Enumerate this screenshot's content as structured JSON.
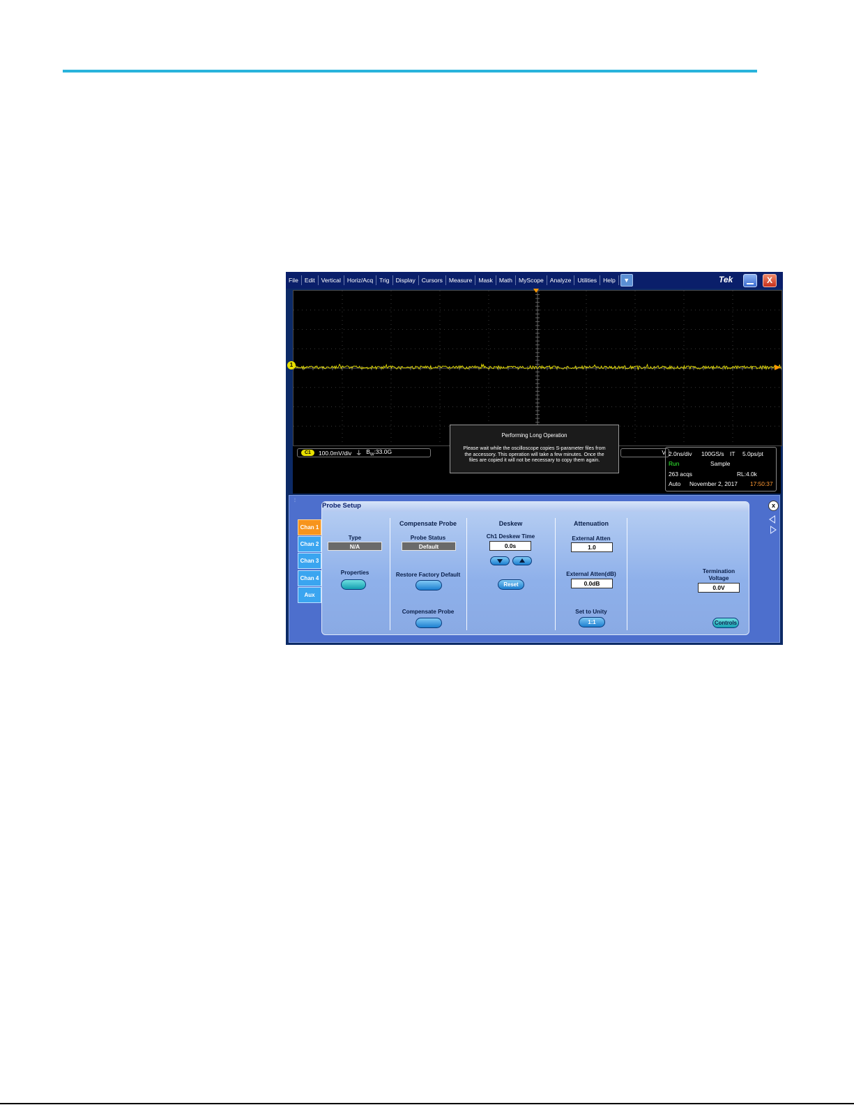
{
  "menu": {
    "items": [
      "File",
      "Edit",
      "Vertical",
      "Horiz/Acq",
      "Trig",
      "Display",
      "Cursors",
      "Measure",
      "Mask",
      "Math",
      "MyScope",
      "Analyze",
      "Utilities",
      "Help"
    ],
    "dropdown": "▼",
    "brand": "Tek",
    "close": "X"
  },
  "graticule": {
    "channel_marker": "1",
    "trace_color": "#e8e000",
    "trigger_color": "#ff9900"
  },
  "channel_readout": {
    "badge": "C1",
    "scale": "100.0mV/div",
    "bandwidth_prefix": "B",
    "bandwidth_sub": "W",
    "bandwidth_value": ":33.0G",
    "partial": "V"
  },
  "acquisition": {
    "timebase": "2.0ns/div",
    "sample_rate": "100GS/s",
    "mode_code": "IT",
    "resolution": "5.0ps/pt",
    "state": "Run",
    "acq_mode": "Sample",
    "acqs": "263 acqs",
    "record_length": "RL:4.0k",
    "trigger_mode": "Auto",
    "date": "November 2, 2017",
    "time": "17:50:37"
  },
  "long_operation": {
    "title": "Performing Long Operation",
    "message": "Please wait while the oscilloscope copies S-parameter files from the accessory. This operation will take a few minutes. Once the files are copied it will not be necessary to copy them again."
  },
  "probe_setup": {
    "title": "Probe Setup",
    "close": "x",
    "tabs": [
      "Chan 1",
      "Chan 2",
      "Chan 3",
      "Chan 4",
      "Aux"
    ],
    "type_label": "Type",
    "type_value": "N/A",
    "properties_label": "Properties",
    "compensate_header": "Compensate Probe",
    "probe_status_label": "Probe Status",
    "probe_status_value": "Default",
    "restore_label": "Restore Factory Default",
    "compensate_label": "Compensate Probe",
    "deskew_header": "Deskew",
    "deskew_time_label": "Ch1 Deskew Time",
    "deskew_time_value": "0.0s",
    "reset_label": "Reset",
    "attenuation_header": "Attenuation",
    "external_atten_label": "External Atten",
    "external_atten_value": "1.0",
    "external_atten_db_label": "External Atten(dB)",
    "external_atten_db_value": "0.0dB",
    "set_unity_label": "Set to Unity",
    "unity_button": "1:1",
    "termination_label_1": "Termination",
    "termination_label_2": "Voltage",
    "termination_value": "0.0V",
    "controls_label": "Controls"
  }
}
